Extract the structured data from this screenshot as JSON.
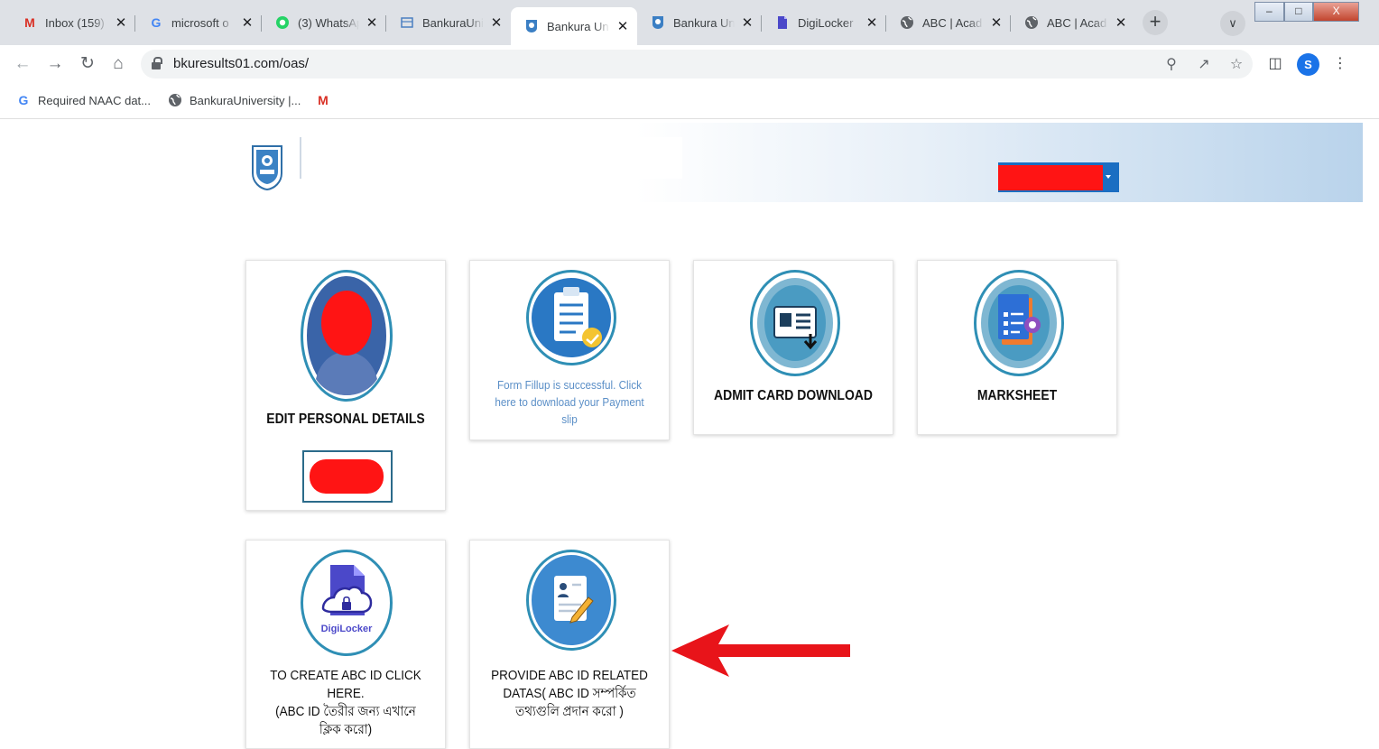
{
  "browser": {
    "tabs": [
      {
        "label": "Inbox (159)",
        "icon": "gmail-icon",
        "active": false
      },
      {
        "label": "microsoft o",
        "icon": "google-icon",
        "active": false
      },
      {
        "label": "(3) WhatsApp",
        "icon": "whatsapp-icon",
        "active": false
      },
      {
        "label": "BankuraUni",
        "icon": "docs-icon",
        "active": false
      },
      {
        "label": "Bankura Un",
        "icon": "university-logo-icon",
        "active": true
      },
      {
        "label": "Bankura Un",
        "icon": "university-logo-icon",
        "active": false
      },
      {
        "label": "DigiLocker",
        "icon": "digilocker-icon",
        "active": false
      },
      {
        "label": "ABC | Acad",
        "icon": "globe-icon",
        "active": false
      },
      {
        "label": "ABC | Acad",
        "icon": "globe-icon",
        "active": false
      }
    ],
    "close_glyph": "✕",
    "url": "bkuresults01.com/oas/",
    "profile_initial": "S",
    "bookmarks": [
      {
        "label": "Required NAAC dat...",
        "icon": "google-icon"
      },
      {
        "label": "BankuraUniversity |...",
        "icon": "globe-icon"
      },
      {
        "label": "",
        "icon": "gmail-icon"
      }
    ]
  },
  "colors": {
    "accent_blue": "#1b6ec2",
    "circle_ring": "#2f8fb5",
    "notice_text": "#5b8fc7",
    "redaction": "#ff1414",
    "arrow_red": "#e8141a"
  },
  "cards": {
    "edit_personal": {
      "label": "EDIT PERSONAL DETAILS",
      "icon": "student-photo-icon"
    },
    "form_fillup": {
      "notice": "Form Fillup is successful. Click here to download your Payment slip",
      "icon": "clipboard-icon"
    },
    "admit_card": {
      "label": "ADMIT CARD DOWNLOAD",
      "icon": "id-card-download-icon"
    },
    "marksheet": {
      "label": "MARKSHEET",
      "icon": "marksheet-icon"
    },
    "abc_create": {
      "label_line1": "TO CREATE ABC ID CLICK",
      "label_line2": "HERE.",
      "label_line3": "(ABC ID তৈরীর জন্য এখানে",
      "label_line4": "ক্লিক করো)",
      "icon": "digilocker-icon",
      "icon_text": "DigiLocker"
    },
    "abc_provide": {
      "label_line1": "PROVIDE ABC ID RELATED",
      "label_line2": "DATAS( ABC ID সম্পর্কিত",
      "label_line3": "তথ্যগুলি প্রদান করো )",
      "icon": "form-edit-icon"
    }
  }
}
